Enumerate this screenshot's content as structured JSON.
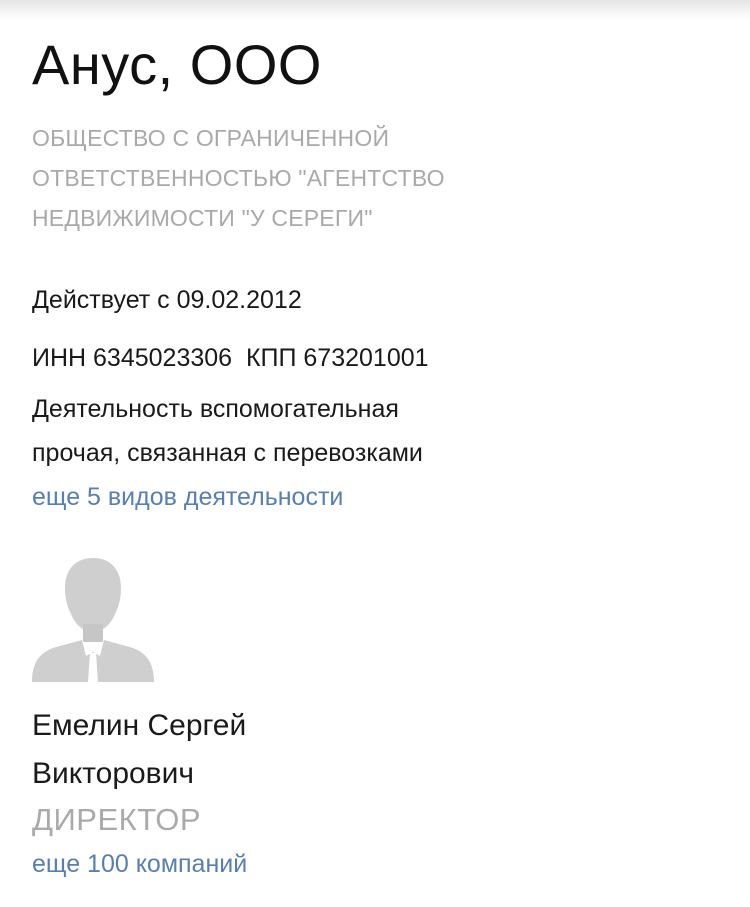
{
  "company": {
    "title": "Анус, ООО",
    "legal_name_lines": [
      "ОБЩЕСТВО С ОГРАНИЧЕННОЙ",
      "ОТВЕТСТВЕННОСТЬЮ \"АГЕНТСТВО",
      "НЕДВИЖИМОСТИ \"У СЕРЕГИ\""
    ],
    "status": "Действует с 09.02.2012",
    "ids": "ИНН 6345023306  КПП 673201001",
    "activity_lines": [
      "Деятельность вспомогательная",
      "прочая, связанная с перевозками"
    ],
    "more_activities_link": "еще 5 видов деятельности"
  },
  "person": {
    "avatar_icon": "person-silhouette-icon",
    "name_lines": [
      "Емелин Сергей",
      "Викторович"
    ],
    "role": "ДИРЕКТОР",
    "more_companies_link": "еще 100 компаний"
  },
  "colors": {
    "link": "#5a7fab",
    "muted": "#a9a9a9",
    "text": "#1a1a1a"
  }
}
